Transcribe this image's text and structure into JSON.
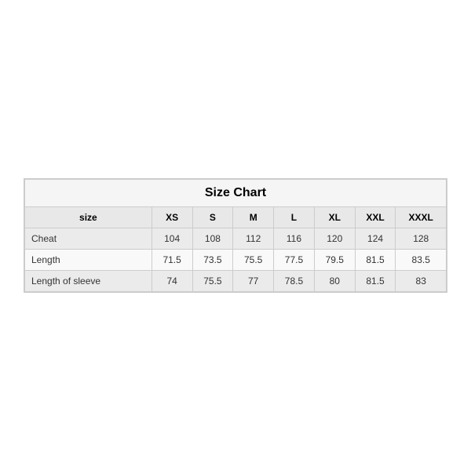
{
  "table": {
    "title": "Size Chart",
    "headers": [
      "size",
      "XS",
      "S",
      "M",
      "L",
      "XL",
      "XXL",
      "XXXL"
    ],
    "rows": [
      {
        "label": "Cheat",
        "values": [
          "104",
          "108",
          "112",
          "116",
          "120",
          "124",
          "128"
        ]
      },
      {
        "label": "Length",
        "values": [
          "71.5",
          "73.5",
          "75.5",
          "77.5",
          "79.5",
          "81.5",
          "83.5"
        ]
      },
      {
        "label": "Length of sleeve",
        "values": [
          "74",
          "75.5",
          "77",
          "78.5",
          "80",
          "81.5",
          "83"
        ]
      }
    ]
  }
}
